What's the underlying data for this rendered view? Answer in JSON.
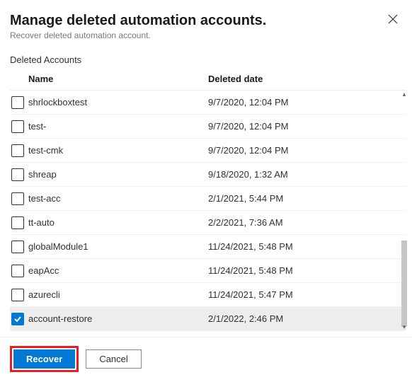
{
  "header": {
    "title": "Manage deleted automation accounts.",
    "subtitle": "Recover deleted automation account."
  },
  "section_label": "Deleted Accounts",
  "columns": {
    "name": "Name",
    "date": "Deleted date"
  },
  "rows": [
    {
      "name": "shrlockboxtest",
      "date": "9/7/2020, 12:04 PM",
      "checked": false
    },
    {
      "name": "test-",
      "date": "9/7/2020, 12:04 PM",
      "checked": false
    },
    {
      "name": "test-cmk",
      "date": "9/7/2020, 12:04 PM",
      "checked": false
    },
    {
      "name": "shreap",
      "date": "9/18/2020, 1:32 AM",
      "checked": false
    },
    {
      "name": "test-acc",
      "date": "2/1/2021, 5:44 PM",
      "checked": false
    },
    {
      "name": "tt-auto",
      "date": "2/2/2021, 7:36 AM",
      "checked": false
    },
    {
      "name": "globalModule1",
      "date": "11/24/2021, 5:48 PM",
      "checked": false
    },
    {
      "name": "eapAcc",
      "date": "11/24/2021, 5:48 PM",
      "checked": false
    },
    {
      "name": "azurecli",
      "date": "11/24/2021, 5:47 PM",
      "checked": false
    },
    {
      "name": "account-restore",
      "date": "2/1/2022, 2:46 PM",
      "checked": true
    }
  ],
  "footer": {
    "recover": "Recover",
    "cancel": "Cancel"
  }
}
